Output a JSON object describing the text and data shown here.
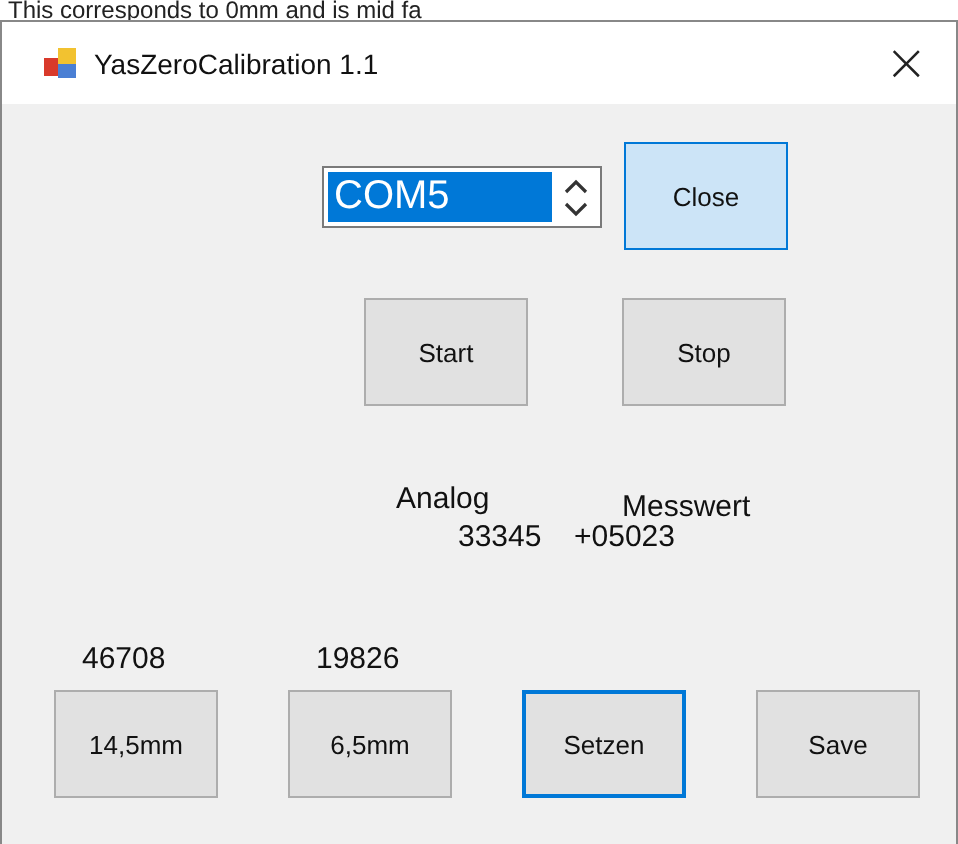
{
  "top_caption": "This corresponds to 0mm and is mid fa",
  "window": {
    "title": "YasZeroCalibration 1.1",
    "close_glyph": "×"
  },
  "port": {
    "value": "COM5",
    "selected": true
  },
  "top_buttons": [
    {
      "label": "Close",
      "hovered": true,
      "focused": false
    }
  ],
  "control_buttons": [
    {
      "label": "Start",
      "hovered": false,
      "focused": false
    },
    {
      "label": "Stop",
      "hovered": false,
      "focused": false
    }
  ],
  "readout": {
    "analog_label": "Analog",
    "measure_label": "Messwert",
    "analog_value": "33345",
    "measure_value": "+05023"
  },
  "calibration": [
    {
      "reading": "46708",
      "label": "14,5mm",
      "hovered": false,
      "focused": false
    },
    {
      "reading": "19826",
      "label": "6,5mm",
      "hovered": false,
      "focused": false
    },
    {
      "label": "Setzen",
      "hovered": false,
      "focused": true
    },
    {
      "label": "Save",
      "hovered": false,
      "focused": false
    }
  ]
}
